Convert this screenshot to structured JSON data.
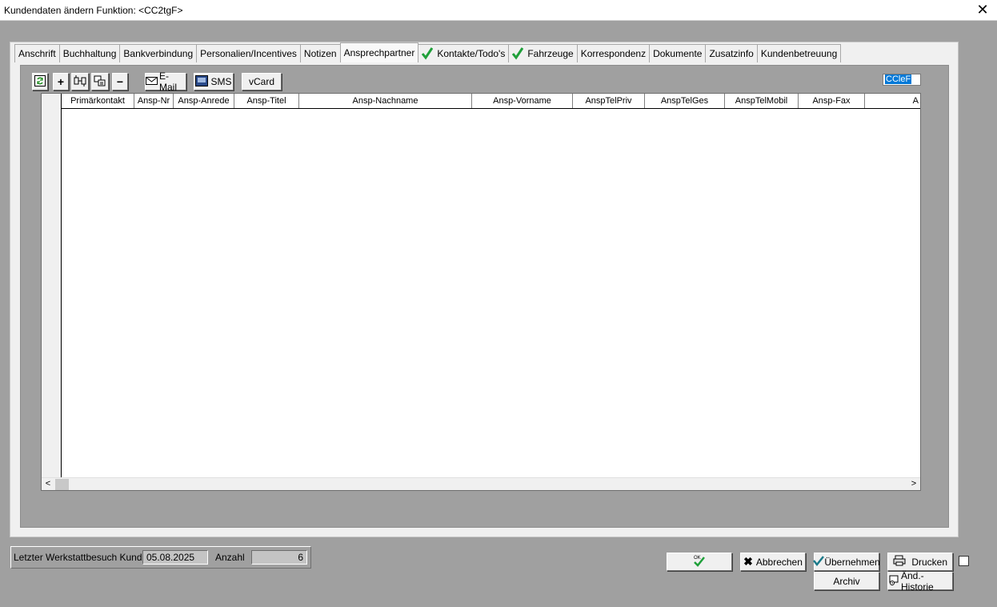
{
  "window": {
    "title": "Kundendaten ändern  Funktion: <CC2tgF>",
    "close_glyph": "✕"
  },
  "tabs": [
    {
      "label": "Anschrift",
      "checked": false,
      "active": false
    },
    {
      "label": "Buchhaltung",
      "checked": false,
      "active": false
    },
    {
      "label": "Bankverbindung",
      "checked": false,
      "active": false
    },
    {
      "label": "Personalien/Incentives",
      "checked": false,
      "active": false
    },
    {
      "label": "Notizen",
      "checked": false,
      "active": false
    },
    {
      "label": "Ansprechpartner",
      "checked": false,
      "active": true
    },
    {
      "label": "Kontakte/Todo's",
      "checked": true,
      "active": false
    },
    {
      "label": "Fahrzeuge",
      "checked": true,
      "active": false
    },
    {
      "label": "Korrespondenz",
      "checked": false,
      "active": false
    },
    {
      "label": "Dokumente",
      "checked": false,
      "active": false
    },
    {
      "label": "Zusatzinfo",
      "checked": false,
      "active": false
    },
    {
      "label": "Kundenbetreuung",
      "checked": false,
      "active": false
    }
  ],
  "toolbar": {
    "refresh_icon": "refresh-icon",
    "add_glyph": "+",
    "remove_glyph": "−",
    "email_label": "E-Mail",
    "sms_label": "SMS",
    "vcard_label": "vCard",
    "field_value": "CCleF"
  },
  "grid": {
    "columns": [
      "Primärkontakt",
      "Ansp-Nr",
      "Ansp-Anrede",
      "Ansp-Titel",
      "Ansp-Nachname",
      "Ansp-Vorname",
      "AnspTelPriv",
      "AnspTelGes",
      "AnspTelMobil",
      "Ansp-Fax",
      "A"
    ],
    "rows": [],
    "scroll_left": "<",
    "scroll_right": ">"
  },
  "footer": {
    "last_visit_label": "Letzter Werkstattbesuch Kunde",
    "last_visit_value": "05.08.2025",
    "count_label": "Anzahl",
    "count_value": "6",
    "ok_label": "OK",
    "cancel_label": "Abbrechen",
    "apply_label": "Übernehmen",
    "print_label": "Drucken",
    "archive_label": "Archiv",
    "history_label": "Änd.-Historie"
  },
  "colors": {
    "background": "#a0a0a0",
    "panel": "#f0f0f0",
    "check_green": "#1fa03a",
    "selection_blue": "#0078d7"
  }
}
